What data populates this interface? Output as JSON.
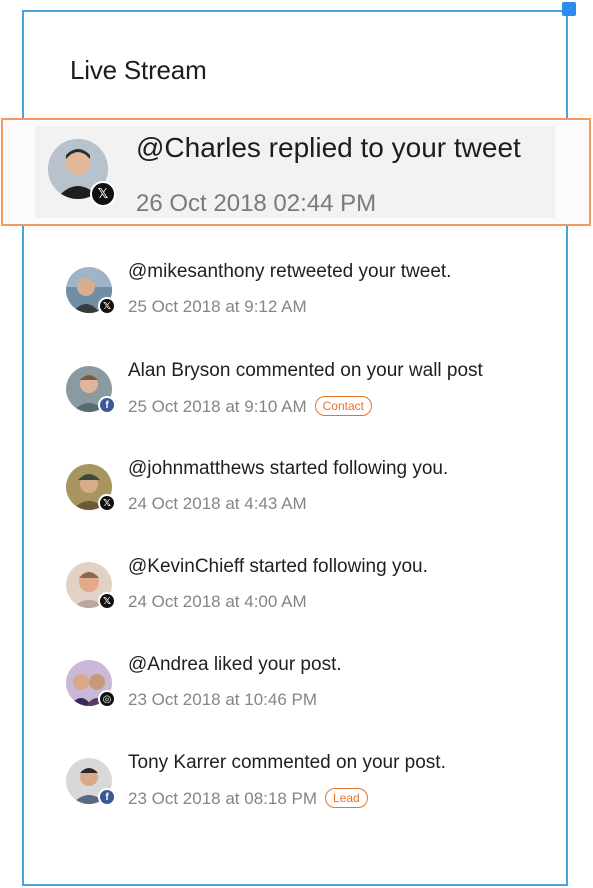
{
  "header": {
    "title": "Live Stream"
  },
  "highlighted": {
    "text": "@Charles replied to your tweet",
    "time": "26 Oct 2018 02:44 PM",
    "network": "x-icon"
  },
  "items": [
    {
      "text": "@mikesanthony retweeted your tweet.",
      "time": "25 Oct 2018 at 9:12 AM",
      "network": "x-icon",
      "tag": "",
      "avatar_color": "#8aa0b5"
    },
    {
      "text": "Alan Bryson commented on your wall post",
      "time": "25 Oct 2018 at 9:10 AM",
      "network": "facebook-icon",
      "tag": "Contact",
      "avatar_color": "#7b8a8f"
    },
    {
      "text": "@johnmatthews started following you.",
      "time": "24 Oct 2018 at 4:43 AM",
      "network": "x-icon",
      "tag": "",
      "avatar_color": "#9a8a5a"
    },
    {
      "text": "@KevinChieff started following you.",
      "time": "24 Oct 2018 at 4:00 AM",
      "network": "x-icon",
      "tag": "",
      "avatar_color": "#c79b7f"
    },
    {
      "text": "@Andrea liked your post.",
      "time": "23 Oct 2018 at 10:46 PM",
      "network": "instagram-icon",
      "tag": "",
      "avatar_color": "#6d5a8c"
    },
    {
      "text": "Tony Karrer commented on your post.",
      "time": "23 Oct 2018 at 08:18 PM",
      "network": "facebook-icon",
      "tag": "Lead",
      "avatar_color": "#6f7d8c"
    }
  ],
  "colors": {
    "panel_border": "#4aa2df",
    "highlight_border": "#f29a5e",
    "tag": "#e8732a"
  }
}
